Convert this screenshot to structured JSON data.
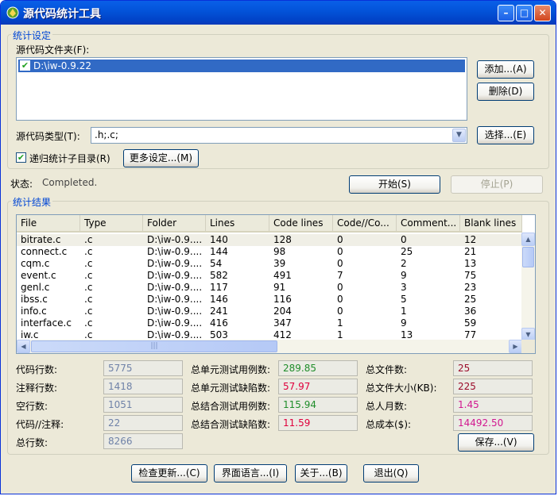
{
  "window": {
    "title": "源代码统计工具",
    "controls": {
      "minimize": "–",
      "maximize": "□",
      "close": "✕"
    }
  },
  "settings": {
    "group_title": "统计设定",
    "folder_label": "源代码文件夹(F):",
    "folders": [
      "D:\\iw-0.9.22"
    ],
    "add_button": "添加...(A)",
    "delete_button": "删除(D)",
    "type_label": "源代码类型(T):",
    "type_value": ".h;.c;",
    "choose_button": "选择...(E)",
    "recursive_label": "递归统计子目录(R)",
    "recursive_checked": true,
    "more_button": "更多设定...(M)"
  },
  "status": {
    "label": "状态:",
    "value": "Completed.",
    "start_button": "开始(S)",
    "stop_button": "停止(P)"
  },
  "results": {
    "group_title": "统计结果",
    "columns": [
      "File",
      "Type",
      "Folder",
      "Lines",
      "Code lines",
      "Code//Co...",
      "Comment...",
      "Blank lines"
    ],
    "rows": [
      [
        "bitrate.c",
        ".c",
        "D:\\iw-0.9....",
        "140",
        "128",
        "0",
        "0",
        "12"
      ],
      [
        "connect.c",
        ".c",
        "D:\\iw-0.9....",
        "144",
        "98",
        "0",
        "25",
        "21"
      ],
      [
        "cqm.c",
        ".c",
        "D:\\iw-0.9....",
        "54",
        "39",
        "0",
        "2",
        "13"
      ],
      [
        "event.c",
        ".c",
        "D:\\iw-0.9....",
        "582",
        "491",
        "7",
        "9",
        "75"
      ],
      [
        "genl.c",
        ".c",
        "D:\\iw-0.9....",
        "117",
        "91",
        "0",
        "3",
        "23"
      ],
      [
        "ibss.c",
        ".c",
        "D:\\iw-0.9....",
        "146",
        "116",
        "0",
        "5",
        "25"
      ],
      [
        "info.c",
        ".c",
        "D:\\iw-0.9....",
        "241",
        "204",
        "0",
        "1",
        "36"
      ],
      [
        "interface.c",
        ".c",
        "D:\\iw-0.9....",
        "416",
        "347",
        "1",
        "9",
        "59"
      ],
      [
        "iw.c",
        ".c",
        "D:\\iw-0.9....",
        "503",
        "412",
        "1",
        "13",
        "77"
      ]
    ],
    "hscroll_grip": "|||"
  },
  "stats": {
    "col1": [
      {
        "label": "代码行数:",
        "value": "5775"
      },
      {
        "label": "注释行数:",
        "value": "1418"
      },
      {
        "label": "空行数:",
        "value": "1051"
      },
      {
        "label": "代码//注释:",
        "value": "22"
      },
      {
        "label": "总行数:",
        "value": "8266"
      }
    ],
    "col2": [
      {
        "label": "总单元测试用例数:",
        "value": "289.85"
      },
      {
        "label": "总单元测试缺陷数:",
        "value": "57.97"
      },
      {
        "label": "总结合测试用例数:",
        "value": "115.94"
      },
      {
        "label": "总结合测试缺陷数:",
        "value": "11.59"
      }
    ],
    "col3": [
      {
        "label": "总文件数:",
        "value": "25"
      },
      {
        "label": "总文件大小(KB):",
        "value": "225"
      },
      {
        "label": "总人月数:",
        "value": "1.45"
      },
      {
        "label": "总成本($):",
        "value": "14492.50"
      }
    ],
    "save_button": "保存...(V)"
  },
  "footer": {
    "check_update": "检查更新...(C)",
    "language": "界面语言...(I)",
    "about": "关于...(B)",
    "exit": "退出(Q)"
  },
  "colors": {
    "title_bar": "#0354da",
    "selection": "#316ac5",
    "group_title": "#0046d5"
  }
}
